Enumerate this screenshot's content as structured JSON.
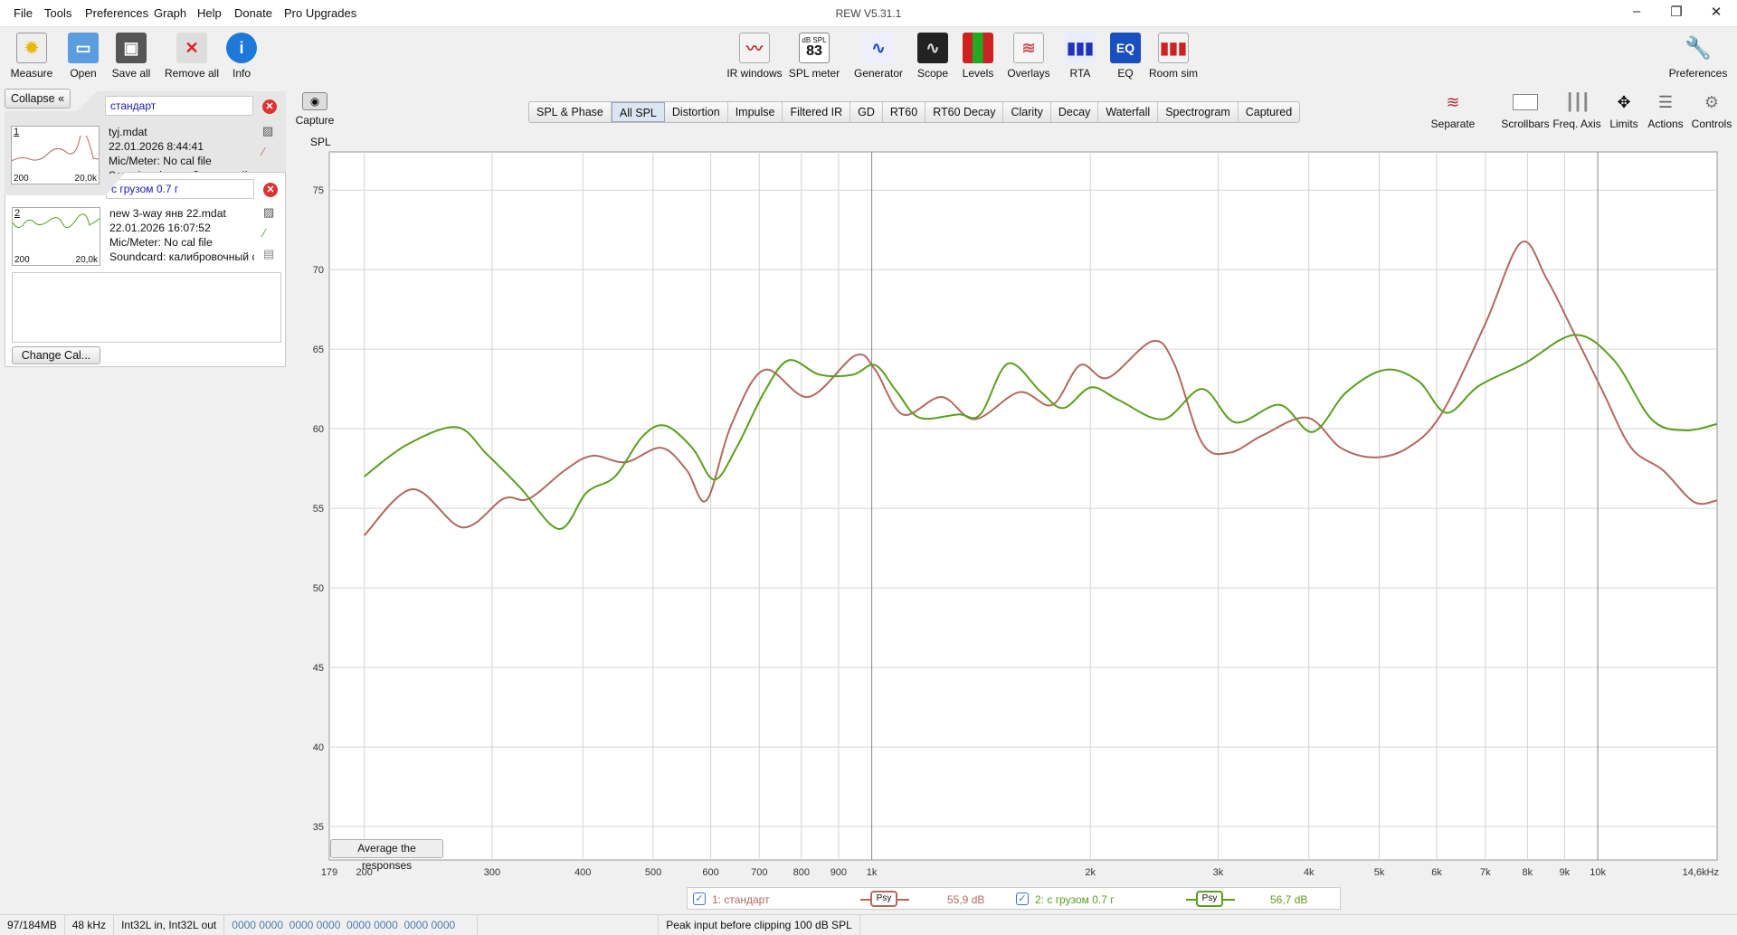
{
  "window": {
    "title": "REW V5.31.1"
  },
  "menu": [
    "File",
    "Tools",
    "Preferences",
    "Graph",
    "Help",
    "Donate",
    "Pro Upgrades"
  ],
  "toolbar_left": [
    {
      "label": "Measure",
      "icon": "measure-icon"
    },
    {
      "label": "Open",
      "icon": "folder-icon"
    },
    {
      "label": "Save all",
      "icon": "save-icon"
    },
    {
      "label": "Remove all",
      "icon": "remove-icon"
    },
    {
      "label": "Info",
      "icon": "info-icon"
    }
  ],
  "toolbar_center": [
    {
      "label": "IR windows",
      "icon": "ir-windows-icon"
    },
    {
      "label": "SPL meter",
      "icon": "spl-meter-icon",
      "badge_top": "dB SPL",
      "badge_value": "83"
    },
    {
      "label": "Generator",
      "icon": "generator-icon"
    },
    {
      "label": "Scope",
      "icon": "scope-icon"
    },
    {
      "label": "Levels",
      "icon": "levels-icon"
    },
    {
      "label": "Overlays",
      "icon": "overlays-icon"
    },
    {
      "label": "RTA",
      "icon": "rta-icon"
    },
    {
      "label": "EQ",
      "icon": "eq-icon"
    },
    {
      "label": "Room sim",
      "icon": "room-sim-icon"
    }
  ],
  "toolbar_right": {
    "label": "Preferences"
  },
  "panel": {
    "collapse_label": "Collapse",
    "measurements": [
      {
        "index": "1",
        "name": "стандарт",
        "file": "tyj.mdat",
        "date": "22.01.2026 8:44:41",
        "mic": "Mic/Meter: No cal file",
        "soundcard": "Soundcard: калибровочный с",
        "thumb_min": "200",
        "thumb_max": "20,0k",
        "color": "#b06a5e"
      },
      {
        "index": "2",
        "name": "с грузом 0.7 г",
        "file": "new 3-way янв 22.mdat",
        "date": "22.01.2026 16:07:52",
        "mic": "Mic/Meter: No cal file",
        "soundcard": "Soundcard: калибровочный с",
        "thumb_min": "200",
        "thumb_max": "20,0k",
        "color": "#5a9e1e"
      }
    ],
    "change_cal_label": "Change Cal..."
  },
  "capture_label": "Capture",
  "tabs": [
    "SPL & Phase",
    "All SPL",
    "Distortion",
    "Impulse",
    "Filtered IR",
    "GD",
    "RT60",
    "RT60 Decay",
    "Clarity",
    "Decay",
    "Waterfall",
    "Spectrogram",
    "Captured"
  ],
  "active_tab": "All SPL",
  "right_controls": [
    {
      "label": "Separate",
      "icon": "separate-icon"
    },
    {
      "label": "Scrollbars",
      "icon": "scrollbars-icon"
    },
    {
      "label": "Freq. Axis",
      "icon": "freq-axis-icon"
    },
    {
      "label": "Limits",
      "icon": "limits-icon"
    },
    {
      "label": "Actions",
      "icon": "actions-icon"
    },
    {
      "label": "Controls",
      "icon": "controls-icon"
    }
  ],
  "average_button": "Average the responses",
  "legend": [
    {
      "label": "1: стандарт",
      "smoothing": "Psy",
      "value": "55,9 dB",
      "color": "#b06a5e",
      "checked": true
    },
    {
      "label": "2: с грузом 0.7 г",
      "smoothing": "Psy",
      "value": "56,7 dB",
      "color": "#5a9e1e",
      "checked": true
    }
  ],
  "status": {
    "memory": "97/184MB",
    "rate": "48 kHz",
    "format": "Int32L in, Int32L out",
    "bits": "0000 0000  0000 0000  0000 0000  0000 0000",
    "peak": "Peak input before clipping 100 dB SPL"
  },
  "chart_data": {
    "type": "line",
    "ylabel": "SPL",
    "xscale": "log",
    "xlim": [
      179,
      14600
    ],
    "ylim": [
      32.9,
      77.4
    ],
    "yticks": [
      35,
      40,
      45,
      50,
      55,
      60,
      65,
      70,
      75
    ],
    "xticks": [
      {
        "v": 179,
        "t": "179"
      },
      {
        "v": 200,
        "t": "200"
      },
      {
        "v": 300,
        "t": "300"
      },
      {
        "v": 400,
        "t": "400"
      },
      {
        "v": 500,
        "t": "500"
      },
      {
        "v": 600,
        "t": "600"
      },
      {
        "v": 700,
        "t": "700"
      },
      {
        "v": 800,
        "t": "800"
      },
      {
        "v": 900,
        "t": "900"
      },
      {
        "v": 1000,
        "t": "1k"
      },
      {
        "v": 2000,
        "t": "2k"
      },
      {
        "v": 3000,
        "t": "3k"
      },
      {
        "v": 4000,
        "t": "4k"
      },
      {
        "v": 5000,
        "t": "5k"
      },
      {
        "v": 6000,
        "t": "6k"
      },
      {
        "v": 7000,
        "t": "7k"
      },
      {
        "v": 8000,
        "t": "8k"
      },
      {
        "v": 9000,
        "t": "9k"
      },
      {
        "v": 10000,
        "t": "10k"
      },
      {
        "v": 14600,
        "t": "14,6kHz"
      }
    ],
    "grid": true,
    "series": [
      {
        "name": "1: стандарт",
        "color": "#b06a5e",
        "x": [
          200,
          233,
          273,
          311,
          337,
          378,
          412,
          458,
          513,
          556,
          592,
          640,
          711,
          818,
          949,
          1011,
          1103,
          1248,
          1387,
          1596,
          1773,
          1937,
          2114,
          2434,
          2609,
          2852,
          3114,
          3458,
          3980,
          4427,
          4922,
          5472,
          6084,
          7000,
          7840,
          8510,
          9300,
          10170,
          11120,
          12290,
          13570,
          14600
        ],
        "y": [
          53.3,
          56.2,
          53.8,
          55.6,
          55.6,
          57.4,
          58.3,
          57.9,
          58.8,
          57.4,
          55.5,
          60.2,
          63.7,
          62.0,
          64.6,
          63.7,
          60.9,
          62.0,
          60.6,
          62.3,
          61.5,
          64.0,
          63.2,
          65.5,
          64.1,
          59.1,
          58.5,
          59.6,
          60.7,
          58.8,
          58.2,
          58.8,
          60.9,
          66.6,
          71.7,
          69.4,
          65.9,
          62.3,
          58.8,
          57.4,
          55.4,
          55.5
        ]
      },
      {
        "name": "2: с грузом 0.7 г",
        "color": "#5a9e1e",
        "x": [
          200,
          229,
          268,
          295,
          328,
          371,
          405,
          443,
          483,
          519,
          566,
          607,
          651,
          711,
          768,
          848,
          942,
          1011,
          1084,
          1163,
          1315,
          1411,
          1541,
          1711,
          1836,
          2005,
          2190,
          2520,
          2852,
          3168,
          3646,
          4051,
          4506,
          5093,
          5660,
          6192,
          6860,
          7925,
          9300,
          10530,
          11860,
          13180,
          14600
        ],
        "y": [
          57.0,
          59.0,
          60.1,
          58.4,
          56.3,
          53.7,
          56.0,
          57.0,
          59.5,
          60.2,
          58.8,
          56.8,
          58.8,
          62.3,
          64.3,
          63.4,
          63.4,
          64.0,
          62.3,
          60.7,
          60.9,
          60.9,
          64.1,
          62.3,
          61.3,
          62.6,
          61.8,
          60.6,
          62.5,
          60.4,
          61.5,
          59.8,
          62.3,
          63.7,
          63.0,
          61.0,
          62.7,
          64.1,
          65.9,
          64.3,
          60.6,
          59.9,
          60.3
        ]
      }
    ]
  }
}
